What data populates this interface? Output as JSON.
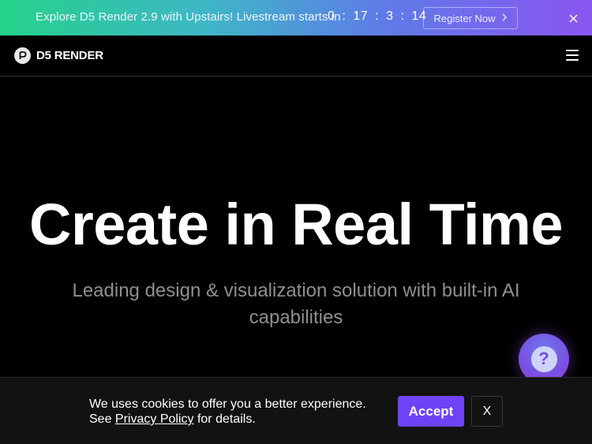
{
  "promo": {
    "text": "Explore D5 Render 2.9 with Upstairs! Livestream starts in",
    "countdown": [
      "0",
      "17",
      "3",
      "14"
    ],
    "separator": ":",
    "register_label": "Register Now"
  },
  "navbar": {
    "logo_text": "D5 RENDER"
  },
  "hero": {
    "title": "Create in Real Time",
    "subtitle": "Leading design & visualization solution with built-in AI capabilities"
  },
  "help": {
    "glyph": "?"
  },
  "cookie": {
    "line1": "We uses cookies to offer you a better experience.",
    "line2_prefix": "See",
    "link": "Privacy Policy",
    "line2_suffix": "for details.",
    "accept_label": "Accept",
    "close_label": "X"
  },
  "colors": {
    "accent": "#6f43f5",
    "background": "#000000",
    "subtitle": "#8f8f8f"
  }
}
